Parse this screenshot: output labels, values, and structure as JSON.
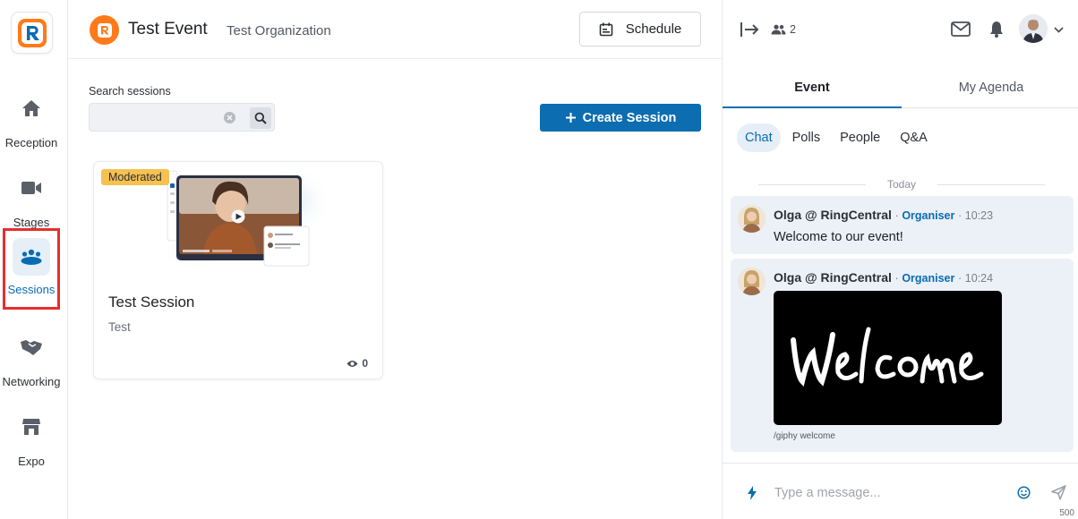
{
  "header": {
    "event_title": "Test Event",
    "organization": "Test Organization",
    "schedule_label": "Schedule"
  },
  "rail": {
    "items": [
      {
        "label": "Reception",
        "icon": "home-icon"
      },
      {
        "label": "Stages",
        "icon": "video-camera-icon"
      },
      {
        "label": "Sessions",
        "icon": "group-icon",
        "active": true
      },
      {
        "label": "Networking",
        "icon": "handshake-icon"
      },
      {
        "label": "Expo",
        "icon": "storefront-icon"
      }
    ]
  },
  "main": {
    "search_label": "Search sessions",
    "search_value": "",
    "create_label": "Create Session",
    "card": {
      "badge": "Moderated",
      "title": "Test Session",
      "subtitle": "Test",
      "views": "0"
    }
  },
  "right_panel": {
    "attendee_count": "2",
    "tabs": [
      {
        "label": "Event",
        "active": true
      },
      {
        "label": "My Agenda"
      }
    ],
    "sub_tabs": [
      "Chat",
      "Polls",
      "People",
      "Q&A"
    ],
    "day_label": "Today",
    "messages": [
      {
        "author": "Olga @ RingCentral",
        "role": "Organiser",
        "time": "10:23",
        "text": "Welcome to our event!"
      },
      {
        "author": "Olga @ RingCentral",
        "role": "Organiser",
        "time": "10:24",
        "gif_caption": "/giphy welcome"
      }
    ],
    "composer_placeholder": "Type a message...",
    "char_limit": "500"
  },
  "colors": {
    "accent": "#0c6db0",
    "event_logo": "#ff7a1a",
    "badge": "#f5c150",
    "highlight_box": "#e62e2e"
  }
}
